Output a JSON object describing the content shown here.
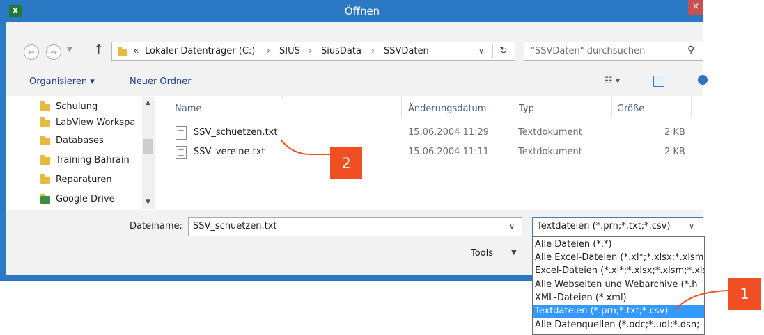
{
  "window": {
    "title": "Öffnen",
    "close_glyph": "×"
  },
  "address": {
    "crumbs": [
      "«",
      "Lokaler Datenträger (C:)",
      "›",
      "SIUS",
      "›",
      "SiusData",
      "›",
      "SSVDaten"
    ],
    "search_placeholder": "\"SSVDaten\" durchsuchen"
  },
  "toolbar": {
    "organize": "Organisieren ▾",
    "new_folder": "Neuer Ordner"
  },
  "nav_items": [
    "Schulung",
    "LabView Workspa",
    "Databases",
    "Training Bahrain",
    "Reparaturen",
    "Google Drive"
  ],
  "columns": {
    "name": "Name",
    "date": "Änderungsdatum",
    "type": "Typ",
    "size": "Größe"
  },
  "files": [
    {
      "name": "SSV_schuetzen.txt",
      "date": "15.06.2004 11:29",
      "type": "Textdokument",
      "size": "2 KB"
    },
    {
      "name": "SSV_vereine.txt",
      "date": "15.06.2004 11:11",
      "type": "Textdokument",
      "size": "2 KB"
    }
  ],
  "bottom": {
    "filename_label": "Dateiname:",
    "filename_value": "SSV_schuetzen.txt",
    "filetype_value": "Textdateien (*.prn;*.txt;*.csv)",
    "tools": "Tools"
  },
  "filetype_options": [
    "Alle Dateien (*.*)",
    "Alle Excel-Dateien (*.xl*;*.xlsx;*.xlsm;",
    "Excel-Dateien (*.xl*;*.xlsx;*.xlsm;*.xls",
    "Alle Webseiten und Webarchive (*.h",
    "XML-Dateien (*.xml)",
    "Textdateien (*.prn;*.txt;*.csv)",
    "Alle Datenquellen (*.odc;*.udl;*.dsn;"
  ],
  "selected_filetype_index": 5,
  "callouts": [
    "1",
    "2"
  ],
  "colors": {
    "titlebar": "#2b79c4",
    "callout": "#f04e23",
    "selection": "#3399ff"
  }
}
